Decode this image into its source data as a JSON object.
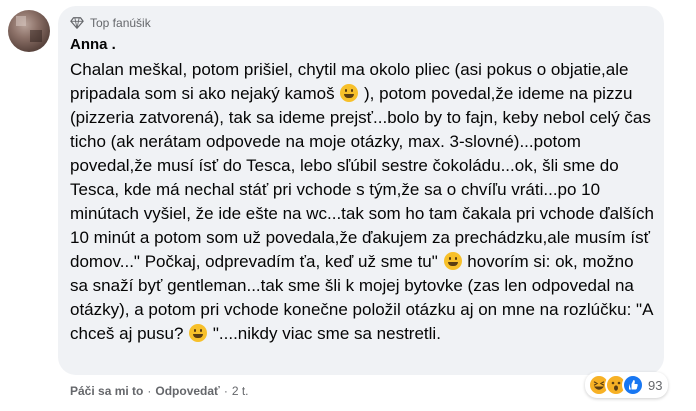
{
  "comment": {
    "badge_label": "Top fanúšik",
    "author": "Anna .",
    "text_parts": [
      "Chalan meškal, potom prišiel, chytil ma okolo pliec (asi pokus o objatie,ale pripadala som si ako nejaký kamoš ",
      " ), potom povedal,že ideme na pizzu (pizzeria zatvorená), tak sa ideme prejsť...bolo by to fajn, keby nebol celý čas ticho (ak nerátam odpovede na moje otázky, max. 3-slovné)...potom povedal,že musí ísť do Tesca, lebo sľúbil sestre čokoládu...ok, šli sme do Tesca, kde má nechal stáť pri vchode s tým,že sa o chvíľu vráti...po 10 minútach vyšiel, že ide ešte na wc...tak som ho tam čakala pri vchode ďalších 10 minút a potom som už povedala,že ďakujem za prechádzku,ale musím ísť domov...\" Počkaj, odprevadím ťa, keď už sme tu\" ",
      " hovorím si: ok, možno sa snaží byť gentleman...tak sme šli k mojej bytovke (zas len odpovedal na otázky), a potom pri vchode konečne položil otázku aj on mne na rozlúčku: \"A chceš aj pusu? ",
      " \"....nikdy viac sme sa nestretli."
    ],
    "emoji_icons": [
      "grinning-face-icon",
      "grinning-face-icon",
      "grinning-face-icon"
    ]
  },
  "actions": {
    "like_label": "Páči sa mi to",
    "separator": "·",
    "reply_label": "Odpovedať",
    "time": "2 t."
  },
  "reactions": {
    "icons": [
      "haha-reaction-icon",
      "wow-reaction-icon",
      "like-reaction-icon"
    ],
    "count": "93"
  },
  "colors": {
    "bubble_bg": "#f0f2f5",
    "secondary_text": "#65676b",
    "like_blue": "#1877f2",
    "reaction_yellow": "#f7b125"
  }
}
